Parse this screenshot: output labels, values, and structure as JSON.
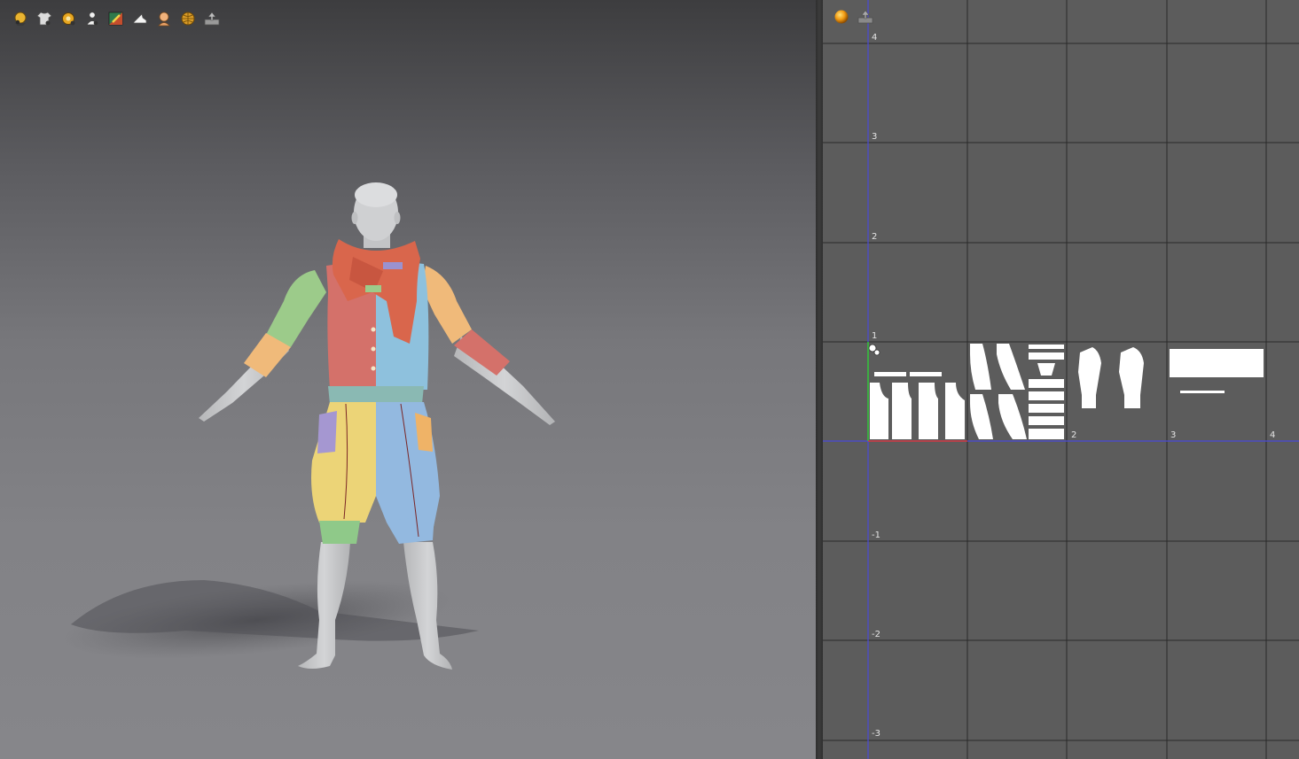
{
  "viewport3d": {
    "toolbar": [
      {
        "icon": "avatar-display-icon"
      },
      {
        "icon": "garment-display-icon"
      },
      {
        "icon": "texture-display-icon"
      },
      {
        "icon": "avatar-view-icon"
      },
      {
        "icon": "fabric-render-icon"
      },
      {
        "icon": "shoe-display-icon"
      },
      {
        "icon": "skin-display-icon"
      },
      {
        "icon": "world-display-icon"
      },
      {
        "icon": "export-icon"
      }
    ],
    "colors": {
      "bg_top": "#3d3d3f",
      "bg_bottom": "#86868a",
      "avatar_skin": "#c9cacc",
      "scarf": "#d9664c",
      "shirt_red": "#d4716a",
      "shirt_blue": "#8ec1dd",
      "sleeve_green": "#9ccb8a",
      "sleeve_orange": "#f0ba7a",
      "waistband": "#8ab9b3",
      "pants_yellow": "#ecd477",
      "pants_blue": "#93b9e0",
      "pocket_purple": "#a597d1",
      "pocket_orange": "#efb367",
      "cuff_green": "#8fc989"
    }
  },
  "viewport2d": {
    "toolbar": [
      {
        "icon": "material-sphere-icon"
      },
      {
        "icon": "export-icon"
      }
    ],
    "y_axis_labels": [
      "4",
      "3",
      "2",
      "1",
      "-1",
      "-2",
      "-3"
    ],
    "x_axis_labels": [
      "2",
      "3",
      "4"
    ],
    "colors": {
      "background": "#5c5c5c",
      "grid_line": "#2a2a2a",
      "axis_v": "#4a4ad8",
      "axis_h": "#4a4ad8",
      "uv_piece": "#ffffff",
      "origin_v": "#32c832",
      "origin_h": "#d23a3a"
    }
  }
}
